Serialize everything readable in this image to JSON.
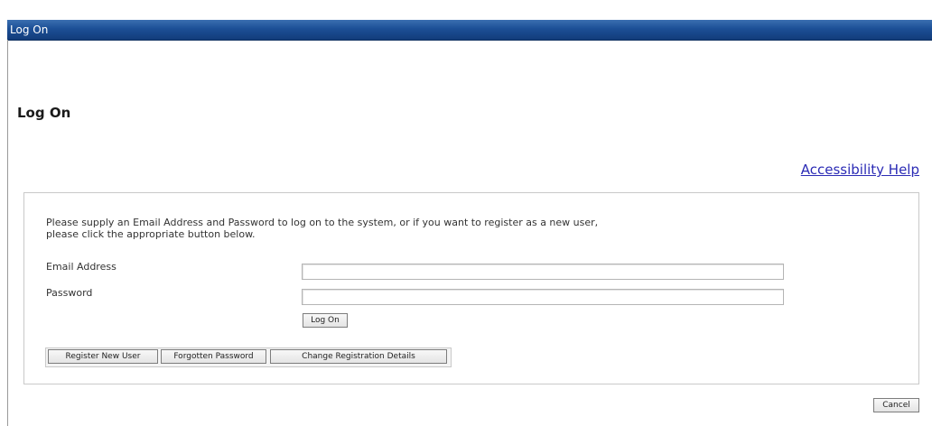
{
  "window": {
    "title": "Log On"
  },
  "page": {
    "heading": "Log On",
    "accessibility_link": "Accessibility Help"
  },
  "form": {
    "instructions_line1": "Please supply an Email Address and Password to log on to the system, or if you want to register as a new user,",
    "instructions_line2": "please click the appropriate button below.",
    "email_label": "Email Address",
    "email_value": "",
    "password_label": "Password",
    "password_value": "",
    "logon_button": "Log On",
    "register_button": "Register New User",
    "forgotten_button": "Forgotten Password",
    "change_details_button": "Change Registration Details"
  },
  "footer": {
    "cancel_button": "Cancel"
  },
  "colors": {
    "title_bar": "#1c4f96",
    "link": "#2b2bb5"
  }
}
